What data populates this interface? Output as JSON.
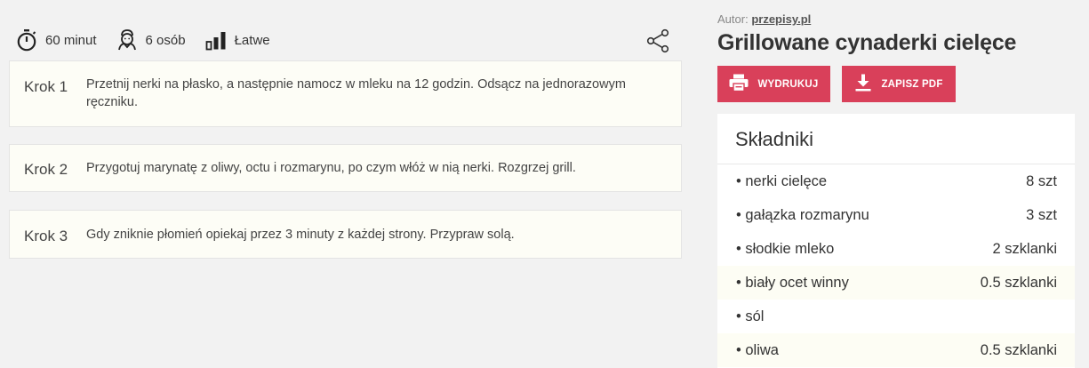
{
  "meta": {
    "time": "60 minut",
    "servings": "6 osób",
    "difficulty": "Łatwe"
  },
  "steps": [
    {
      "label": "Krok 1",
      "text": "Przetnij nerki na płasko, a następnie namocz w mleku na 12 godzin. Odsącz na jednorazowym ręczniku."
    },
    {
      "label": "Krok 2",
      "text": "Przygotuj marynatę z oliwy, octu i rozmarynu, po czym włóż w nią nerki. Rozgrzej grill."
    },
    {
      "label": "Krok 3",
      "text": "Gdy zniknie płomień opiekaj przez 3 minuty z każdej strony. Przypraw solą."
    }
  ],
  "recipe": {
    "author_label": "Autor:",
    "author_name": "przepisy.pl",
    "title": "Grillowane cynaderki cielęce",
    "print_label": "WYDRUKUJ",
    "pdf_label": "ZAPISZ PDF"
  },
  "ingredients": {
    "heading": "Składniki",
    "items": [
      {
        "name": "• nerki cielęce",
        "qty": "8 szt"
      },
      {
        "name": "• gałązka rozmarynu",
        "qty": "3 szt"
      },
      {
        "name": "• słodkie mleko",
        "qty": "2 szklanki"
      },
      {
        "name": "• biały ocet winny",
        "qty": "0.5 szklanki"
      },
      {
        "name": "• sól",
        "qty": ""
      },
      {
        "name": "• oliwa",
        "qty": "0.5 szklanki"
      }
    ]
  },
  "colors": {
    "accent": "#d9405a",
    "step_background": "#fdfdf6",
    "page_background": "#f2f2f2"
  },
  "icons": [
    "stopwatch-icon",
    "chef-icon",
    "difficulty-bars-icon",
    "share-icon",
    "printer-icon",
    "download-icon"
  ]
}
